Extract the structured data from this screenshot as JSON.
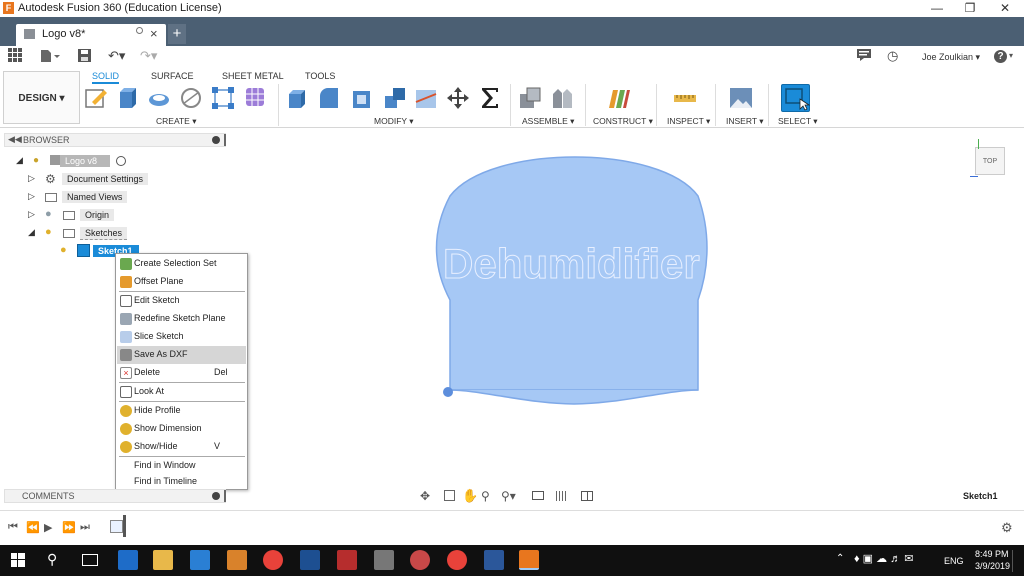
{
  "window": {
    "title": "Autodesk Fusion 360 (Education License)",
    "app_icon": "F"
  },
  "tab": {
    "label": "Logo v8*"
  },
  "qat": {
    "user": "Joe Zoulkian ▾",
    "help": "?"
  },
  "ribbon": {
    "design_label": "DESIGN ▾",
    "tabs": [
      "SOLID",
      "SURFACE",
      "SHEET METAL",
      "TOOLS"
    ],
    "groups": [
      "CREATE ▾",
      "MODIFY ▾",
      "ASSEMBLE ▾",
      "CONSTRUCT ▾",
      "INSPECT ▾",
      "INSERT ▾",
      "SELECT ▾"
    ]
  },
  "browser": {
    "header": "BROWSER",
    "nodes": {
      "root": "Logo v8",
      "doc_settings": "Document Settings",
      "named_views": "Named Views",
      "origin": "Origin",
      "sketches": "Sketches",
      "sketch1": "Sketch1"
    }
  },
  "context_menu": {
    "items": [
      {
        "label": "Create Selection Set",
        "shortcut": ""
      },
      {
        "label": "Offset Plane",
        "shortcut": ""
      },
      {
        "label": "Edit Sketch",
        "shortcut": ""
      },
      {
        "label": "Redefine Sketch Plane",
        "shortcut": ""
      },
      {
        "label": "Slice Sketch",
        "shortcut": ""
      },
      {
        "label": "Save As DXF",
        "shortcut": ""
      },
      {
        "label": "Delete",
        "shortcut": "Del"
      },
      {
        "label": "Look At",
        "shortcut": ""
      },
      {
        "label": "Hide Profile",
        "shortcut": ""
      },
      {
        "label": "Show Dimension",
        "shortcut": ""
      },
      {
        "label": "Show/Hide",
        "shortcut": "V"
      },
      {
        "label": "Find in Window",
        "shortcut": ""
      },
      {
        "label": "Find in Timeline",
        "shortcut": ""
      }
    ]
  },
  "canvas": {
    "sketch_text": "Dehumidifier",
    "viewcube": "TOP",
    "status": "Sketch1"
  },
  "comments": {
    "label": "COMMENTS"
  },
  "taskbar": {
    "time": "8:49 PM",
    "date": "3/9/2019",
    "lang": "ENG"
  },
  "colors": {
    "accent": "#1a8bd8",
    "tabbar": "#4b5f73",
    "sketch_fill": "#a6c8f5",
    "sketch_edge": "#7fa9e8"
  }
}
